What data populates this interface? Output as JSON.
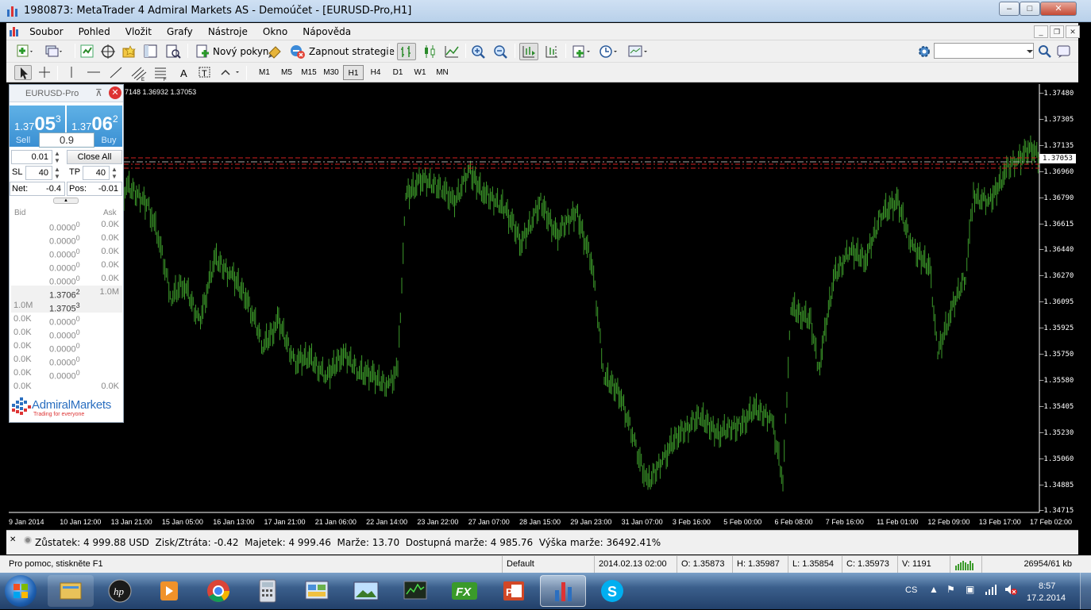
{
  "window": {
    "title": "1980873: MetaTrader 4 Admiral Markets AS - Demoúčet - [EURUSD-Pro,H1]",
    "min": "–",
    "max": "□",
    "close": "✕"
  },
  "menu": [
    "Soubor",
    "Pohled",
    "Vložit",
    "Grafy",
    "Nástroje",
    "Okno",
    "Nápověda"
  ],
  "toolbar": {
    "new_order": "Nový pokyn",
    "autotrading": "Zapnout strategie",
    "timeframes": [
      "M1",
      "M5",
      "M15",
      "M30",
      "H1",
      "H4",
      "D1",
      "W1",
      "MN"
    ],
    "active_timeframe": "H1"
  },
  "chart": {
    "ohlc_text": "7148 1.36932 1.37053",
    "current_price": "1.37053",
    "price_ticks": [
      "1.37480",
      "1.37305",
      "1.37135",
      "1.36960",
      "1.36790",
      "1.36615",
      "1.36440",
      "1.36270",
      "1.36095",
      "1.35925",
      "1.35750",
      "1.35580",
      "1.35405",
      "1.35230",
      "1.35060",
      "1.34885",
      "1.34715"
    ],
    "time_ticks": [
      "9 Jan 2014",
      "10 Jan 12:00",
      "13 Jan 21:00",
      "15 Jan 05:00",
      "16 Jan 13:00",
      "17 Jan 21:00",
      "21 Jan 06:00",
      "22 Jan 14:00",
      "23 Jan 22:00",
      "27 Jan 07:00",
      "28 Jan 15:00",
      "29 Jan 23:00",
      "31 Jan 07:00",
      "3 Feb 16:00",
      "5 Feb 00:00",
      "6 Feb 08:00",
      "7 Feb 16:00",
      "11 Feb 01:00",
      "12 Feb 09:00",
      "13 Feb 17:00",
      "17 Feb 02:00"
    ],
    "candle_color": "#3c9a2a",
    "line_color": "#d22020"
  },
  "one_click": {
    "symbol": "EURUSD-Pro",
    "sell": {
      "prefix": "1.37",
      "big": "05",
      "sup": "3",
      "label": "Sell"
    },
    "buy": {
      "prefix": "1.37",
      "big": "06",
      "sup": "2",
      "label": "Buy"
    },
    "volume": "0.9",
    "lot": "0.01",
    "close_all": "Close All",
    "sl_label": "SL",
    "sl": "40",
    "tp_label": "TP",
    "tp": "40",
    "net_label": "Net:",
    "net": "-0.4",
    "pos_label": "Pos:",
    "pos": "-0.01",
    "bid_header": "Bid",
    "ask_header": "Ask",
    "rows": [
      {
        "l": "",
        "p": "0.0000",
        "s": "0",
        "r": "0.0K"
      },
      {
        "l": "",
        "p": "0.0000",
        "s": "0",
        "r": "0.0K"
      },
      {
        "l": "",
        "p": "0.0000",
        "s": "0",
        "r": "0.0K"
      },
      {
        "l": "",
        "p": "0.0000",
        "s": "0",
        "r": "0.0K"
      },
      {
        "l": "",
        "p": "0.0000",
        "s": "0",
        "r": "0.0K"
      },
      {
        "l": "",
        "p": "1.3706",
        "s": "2",
        "r": "1.0M"
      },
      {
        "l": "1.0M",
        "p": "1.3705",
        "s": "3",
        "r": ""
      },
      {
        "l": "0.0K",
        "p": "0.0000",
        "s": "0",
        "r": ""
      },
      {
        "l": "0.0K",
        "p": "0.0000",
        "s": "0",
        "r": ""
      },
      {
        "l": "0.0K",
        "p": "0.0000",
        "s": "0",
        "r": ""
      },
      {
        "l": "0.0K",
        "p": "0.0000",
        "s": "0",
        "r": ""
      },
      {
        "l": "0.0K",
        "p": "0.0000",
        "s": "0",
        "r": ""
      },
      {
        "l": "0.0K",
        "p": "",
        "s": "",
        "r": "0.0K"
      }
    ],
    "brand": "AdmiralMarkets",
    "brand_tag": "Trading for everyone"
  },
  "account": "Zůstatek: 4 999.88 USD  Zisk/Ztráta: -0.42  Majetek: 4 999.46  Marže: 13.70  Dostupná marže: 4 985.76  Výška marže: 36492.41%",
  "status": {
    "help": "Pro pomoc, stiskněte F1",
    "profile": "Default",
    "datetime": "2014.02.13 02:00",
    "open": "O: 1.35873",
    "high": "H: 1.35987",
    "low": "L: 1.35854",
    "close": "C: 1.35973",
    "volume": "V: 1191",
    "traffic": "26954/61 kb"
  },
  "tray": {
    "lang": "CS",
    "time": "8:57",
    "date": "17.2.2014"
  }
}
